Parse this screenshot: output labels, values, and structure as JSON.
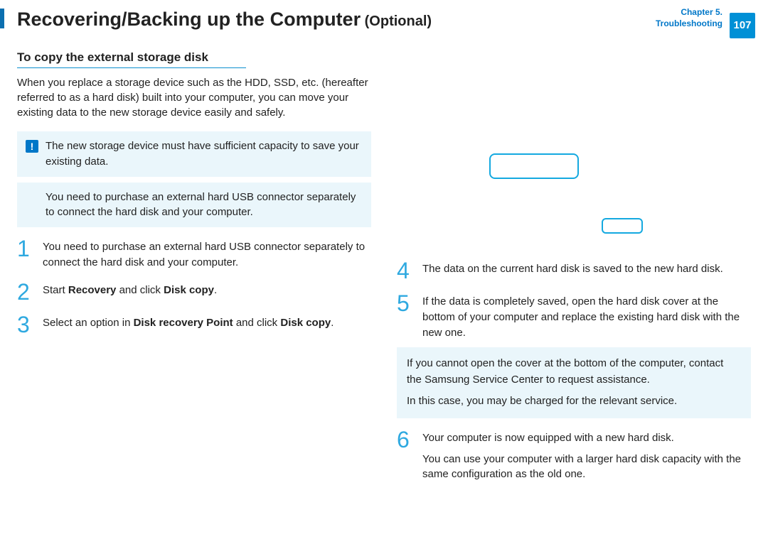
{
  "header": {
    "title_main": "Recovering/Backing up the Computer",
    "title_optional": " (Optional)",
    "chapter_line1": "Chapter 5.",
    "chapter_line2": "Troubleshooting",
    "page_number": "107"
  },
  "left": {
    "subheading": "To copy the external storage disk",
    "intro": "When you replace a storage device such as the HDD, SSD, etc. (hereafter referred to as a hard disk) built into your computer, you can move your existing data to the new storage device easily and safely.",
    "alert_note": "The new storage device must have sufficient capacity to save your existing data.",
    "info_note": "You need to purchase an external hard USB connector separately to connect the hard disk and your computer.",
    "steps": [
      {
        "num": "1",
        "text": "You need to purchase an external hard USB connector separately to connect the hard disk and your computer."
      },
      {
        "num": "2",
        "text_pre": "Start ",
        "bold1": "Recovery",
        "mid": " and click ",
        "bold2": "Disk copy",
        "post": "."
      },
      {
        "num": "3",
        "text_pre": "Select an option in ",
        "bold1": "Disk recovery Point",
        "mid": " and click ",
        "bold2": "Disk copy",
        "post": "."
      }
    ]
  },
  "right": {
    "steps": [
      {
        "num": "4",
        "text": "The data on the current hard disk is saved to the new hard disk."
      },
      {
        "num": "5",
        "text": "If the data is completely saved, open the hard disk cover at the bottom of your computer and replace the existing hard disk with the new one."
      }
    ],
    "note_p1": "If you cannot open the cover at the bottom of the computer, contact the Samsung Service Center to request assistance.",
    "note_p2": "In this case, you may be charged for the relevant service.",
    "step6": {
      "num": "6",
      "p1": "Your computer is now equipped with a new hard disk.",
      "p2": "You can use your computer with a larger hard disk capacity with the same configuration as the old one."
    }
  }
}
